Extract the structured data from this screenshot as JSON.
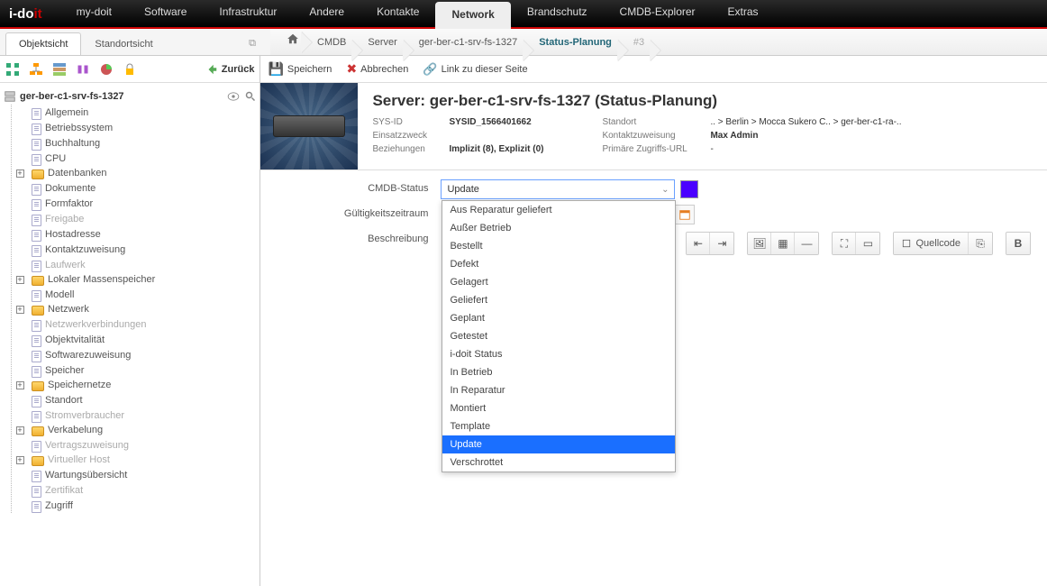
{
  "logo": {
    "left": "i-do",
    "right": "it"
  },
  "topnav": [
    "my-doit",
    "Software",
    "Infrastruktur",
    "Andere",
    "Kontakte",
    "Network",
    "Brandschutz",
    "CMDB-Explorer",
    "Extras"
  ],
  "topnav_active": 5,
  "tabs": {
    "items": [
      "Objektsicht",
      "Standortsicht"
    ],
    "active": 0
  },
  "back_label": "Zurück",
  "tree": {
    "root": "ger-ber-c1-srv-fs-1327",
    "items": [
      {
        "label": "Allgemein",
        "type": "page"
      },
      {
        "label": "Betriebssystem",
        "type": "page"
      },
      {
        "label": "Buchhaltung",
        "type": "page"
      },
      {
        "label": "CPU",
        "type": "page"
      },
      {
        "label": "Datenbanken",
        "type": "folder",
        "expand": true
      },
      {
        "label": "Dokumente",
        "type": "page"
      },
      {
        "label": "Formfaktor",
        "type": "page"
      },
      {
        "label": "Freigabe",
        "type": "page",
        "muted": true
      },
      {
        "label": "Hostadresse",
        "type": "page"
      },
      {
        "label": "Kontaktzuweisung",
        "type": "page"
      },
      {
        "label": "Laufwerk",
        "type": "page",
        "muted": true
      },
      {
        "label": "Lokaler Massenspeicher",
        "type": "folder",
        "expand": true
      },
      {
        "label": "Modell",
        "type": "page"
      },
      {
        "label": "Netzwerk",
        "type": "folder",
        "expand": true
      },
      {
        "label": "Netzwerkverbindungen",
        "type": "page",
        "muted": true
      },
      {
        "label": "Objektvitalität",
        "type": "page"
      },
      {
        "label": "Softwarezuweisung",
        "type": "page"
      },
      {
        "label": "Speicher",
        "type": "page"
      },
      {
        "label": "Speichernetze",
        "type": "folder",
        "expand": true
      },
      {
        "label": "Standort",
        "type": "page"
      },
      {
        "label": "Stromverbraucher",
        "type": "page",
        "muted": true
      },
      {
        "label": "Verkabelung",
        "type": "folder",
        "expand": true
      },
      {
        "label": "Vertragszuweisung",
        "type": "page",
        "muted": true
      },
      {
        "label": "Virtueller Host",
        "type": "folder",
        "expand": true,
        "muted": true
      },
      {
        "label": "Wartungsübersicht",
        "type": "page"
      },
      {
        "label": "Zertifikat",
        "type": "page",
        "muted": true
      },
      {
        "label": "Zugriff",
        "type": "page"
      }
    ]
  },
  "breadcrumb": [
    "CMDB",
    "Server",
    "ger-ber-c1-srv-fs-1327",
    "Status-Planung",
    "#3"
  ],
  "breadcrumb_active": 3,
  "actions": {
    "save": "Speichern",
    "cancel": "Abbrechen",
    "link": "Link zu dieser Seite"
  },
  "header": {
    "title": "Server: ger-ber-c1-srv-fs-1327 (Status-Planung)",
    "rows": [
      {
        "k1": "SYS-ID",
        "v1": "SYSID_1566401662",
        "k2": "Standort",
        "v2": ".. > Berlin > Mocca Sukero C.. > ger-ber-c1-ra-.."
      },
      {
        "k1": "Einsatzzweck",
        "v1": "",
        "k2": "Kontaktzuweisung",
        "v2": "Max Admin"
      },
      {
        "k1": "Beziehungen",
        "v1": "Implizit (8), Explizit (0)",
        "k2": "Primäre Zugriffs-URL",
        "v2": "-"
      }
    ]
  },
  "form": {
    "status_label": "CMDB-Status",
    "status_value": "Update",
    "status_color": "#4a00ff",
    "validity_label": "Gültigkeitszeitraum",
    "desc_label": "Beschreibung",
    "dropdown": [
      "Aus Reparatur geliefert",
      "Außer Betrieb",
      "Bestellt",
      "Defekt",
      "Gelagert",
      "Geliefert",
      "Geplant",
      "Getestet",
      "i-doit Status",
      "In Betrieb",
      "In Reparatur",
      "Montiert",
      "Template",
      "Update",
      "Verschrottet"
    ],
    "dropdown_selected": "Update",
    "source_label": "Quellcode"
  }
}
